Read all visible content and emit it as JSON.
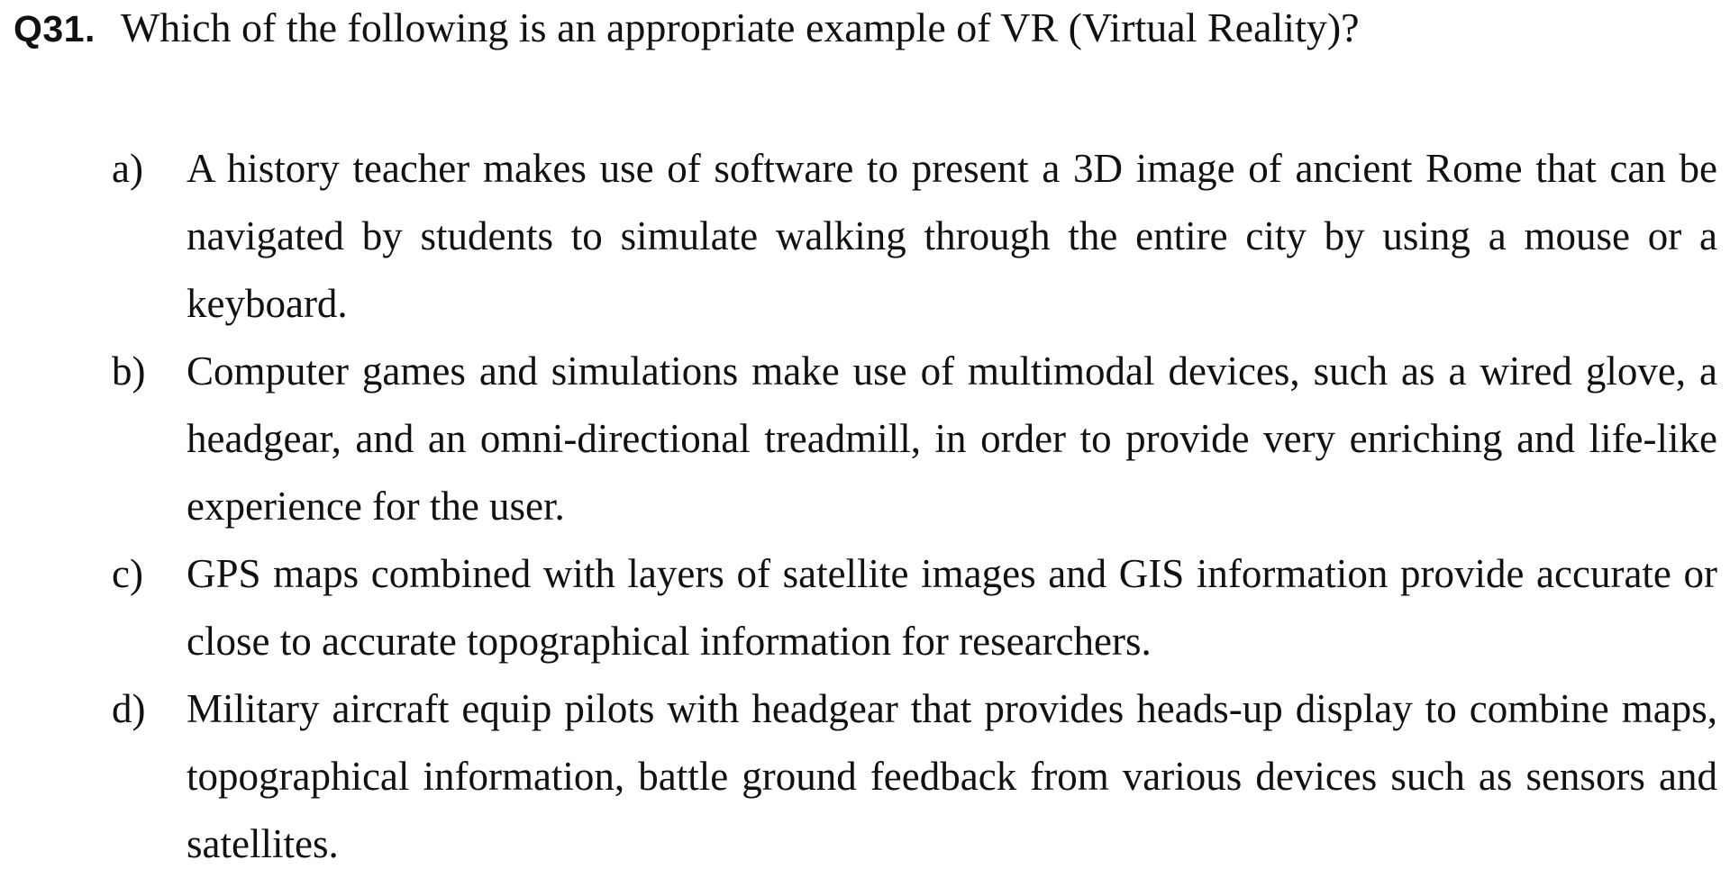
{
  "question": {
    "number": "Q31.",
    "text": "Which of the following is an appropriate example of VR (Virtual Reality)?"
  },
  "options": [
    {
      "letter": "a)",
      "text": "A history teacher makes use of software to present a 3D image of ancient Rome that can be navigated by students to simulate walking through the entire city by using a mouse or a keyboard."
    },
    {
      "letter": "b)",
      "text": "Computer games and simulations make use of multimodal devices, such as a wired glove, a headgear, and an omni-directional treadmill, in order to provide very enriching and life-like experience for the user."
    },
    {
      "letter": "c)",
      "text": "GPS maps combined with layers of satellite images and GIS information provide accurate or close to accurate topographical information for researchers."
    },
    {
      "letter": "d)",
      "text": "Military aircraft equip pilots with headgear that provides heads-up display to combine maps, topographical information, battle ground feedback from various devices such as sensors and satellites."
    }
  ]
}
